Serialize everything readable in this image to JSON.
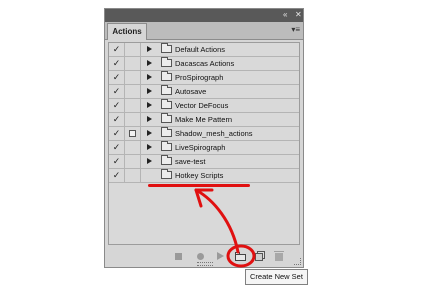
{
  "panel": {
    "tab_label": "Actions",
    "collapse_icon": "double-chevron-icon",
    "close_icon": "close-icon",
    "menu_icon": "panel-menu-icon"
  },
  "actions": [
    {
      "checked": "✓",
      "dialog": false,
      "label": "Default Actions"
    },
    {
      "checked": "✓",
      "dialog": false,
      "label": "Dacascas Actions"
    },
    {
      "checked": "✓",
      "dialog": false,
      "label": "ProSpirograph"
    },
    {
      "checked": "✓",
      "dialog": false,
      "label": "Autosave"
    },
    {
      "checked": "✓",
      "dialog": false,
      "label": "Vector DeFocus"
    },
    {
      "checked": "✓",
      "dialog": false,
      "label": "Make Me Pattern"
    },
    {
      "checked": "✓",
      "dialog": true,
      "label": "Shadow_mesh_actions"
    },
    {
      "checked": "✓",
      "dialog": false,
      "label": "LiveSpirograph"
    },
    {
      "checked": "✓",
      "dialog": false,
      "label": "save-test"
    },
    {
      "checked": "✓",
      "dialog": false,
      "label": "Hotkey Scripts",
      "expanded": false
    }
  ],
  "bottom_bar": {
    "buttons": [
      "stop-icon",
      "record-icon",
      "play-icon",
      "new-set-icon",
      "new-action-icon",
      "trash-icon"
    ]
  },
  "tooltip": {
    "text": "Create New Set"
  },
  "annotation": {
    "color": "#e01010"
  }
}
